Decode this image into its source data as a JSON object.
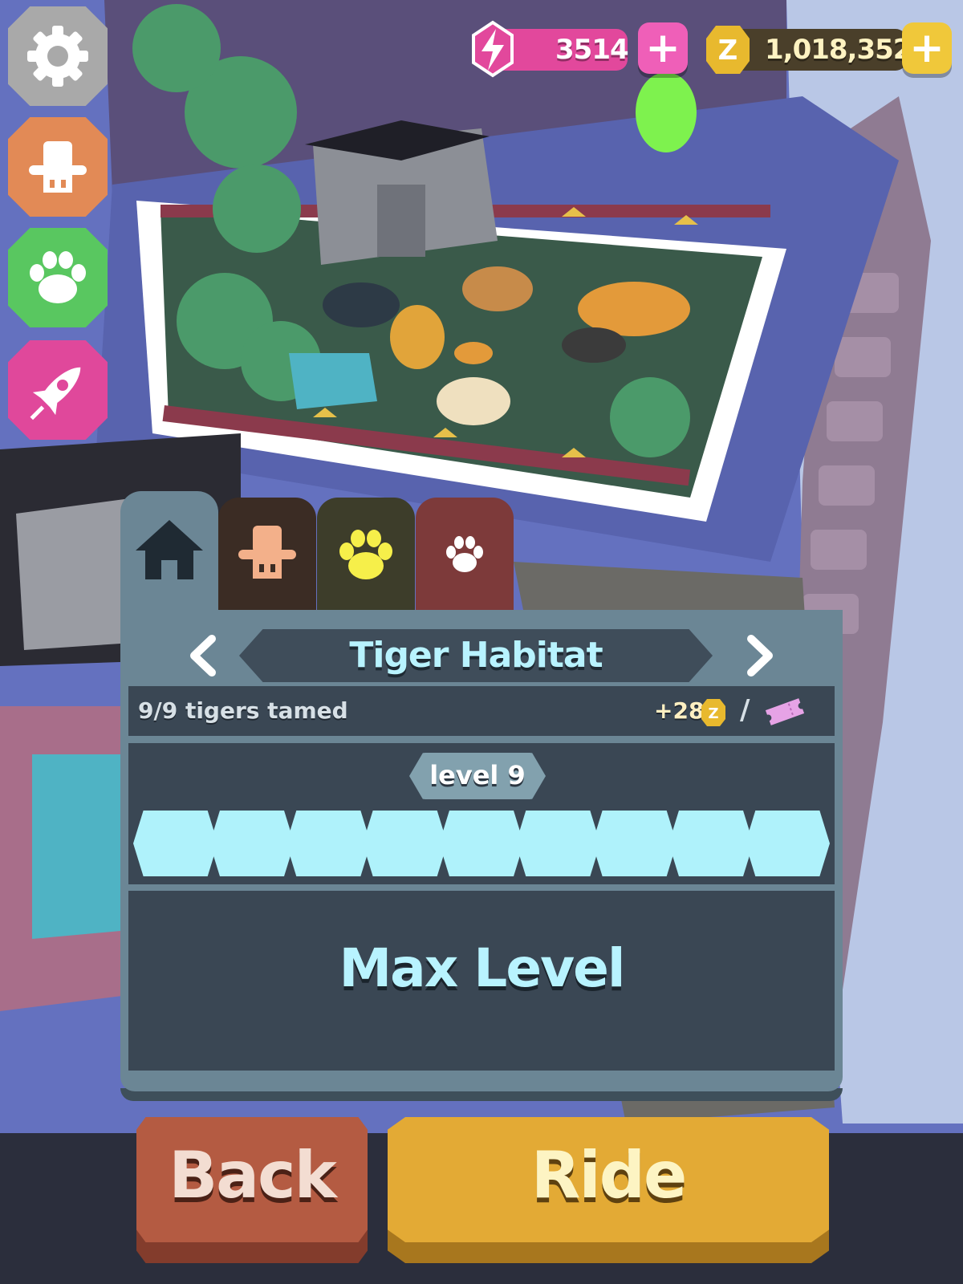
{
  "currency": {
    "energy": "3514",
    "coins": "1,018,352",
    "plus_label": "+"
  },
  "side_menu": {
    "items": [
      "settings",
      "ranger",
      "animals",
      "rocket"
    ]
  },
  "tabs": [
    "habitat",
    "ranger",
    "animals",
    "pets"
  ],
  "habitat": {
    "title": "Tiger Habitat",
    "tamed": "9/9 tigers tamed",
    "reward": "+28",
    "reward_separator": "/",
    "level": "level 9",
    "level_progress": 9,
    "level_max": 9,
    "status": "Max Level"
  },
  "buttons": {
    "back": "Back",
    "ride": "Ride"
  },
  "colors": {
    "energy": "#e2489c",
    "coin": "#f0c83a",
    "progress_fill": "#aff2fb",
    "title_text": "#b8f3ff",
    "back": "#b45b42",
    "ride": "#e3aa35"
  }
}
